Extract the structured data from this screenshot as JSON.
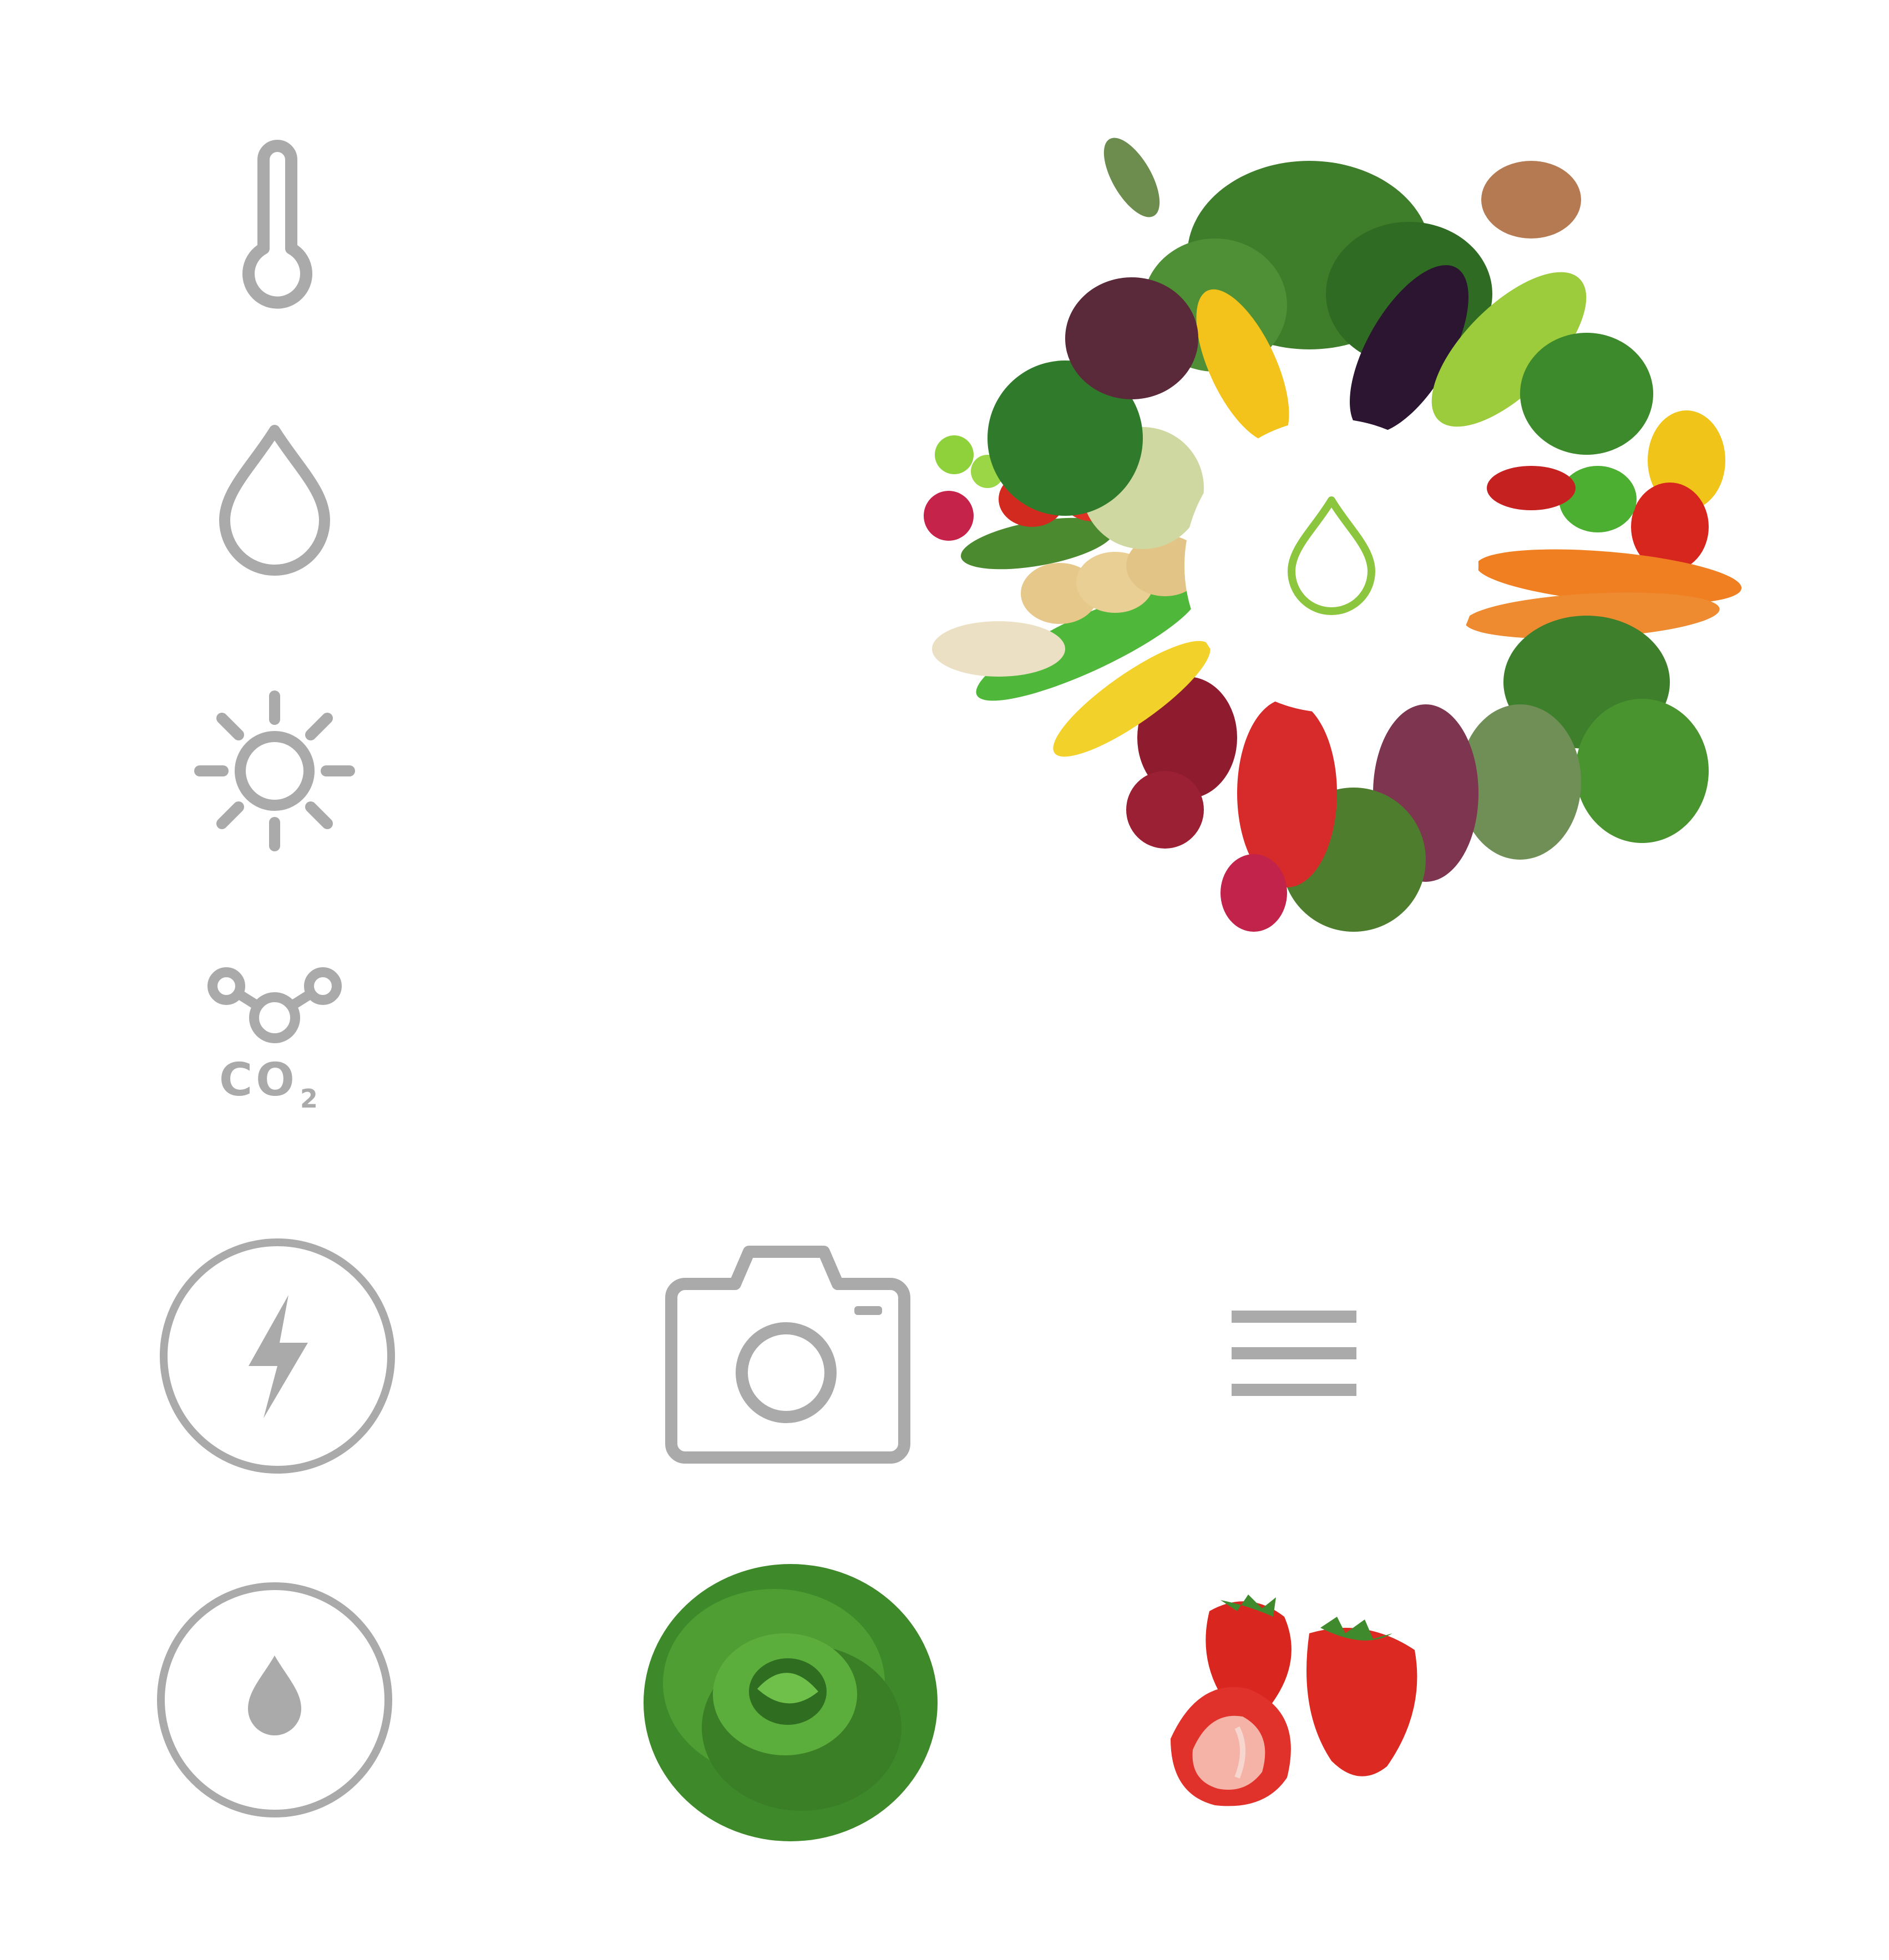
{
  "palette": {
    "icon_gray": "#aaaaaa",
    "accent_green": "#8cc63f",
    "background": "#ffffff"
  },
  "sensors": [
    {
      "icon": "thermometer-icon"
    },
    {
      "icon": "water-drop-icon"
    },
    {
      "icon": "sun-icon"
    },
    {
      "icon": "co2-molecule-icon",
      "label": "CO",
      "label_sub": "2"
    }
  ],
  "hero": {
    "image": "vegetable-wheel-image",
    "center_icon": "water-drop-icon"
  },
  "controls": [
    {
      "icon": "lightning-button-icon"
    },
    {
      "icon": "camera-icon"
    },
    {
      "icon": "hamburger-menu-icon"
    },
    {
      "icon": "water-drop-button-icon"
    }
  ],
  "produce": [
    {
      "icon": "lettuce-image"
    },
    {
      "icon": "strawberries-image"
    }
  ]
}
